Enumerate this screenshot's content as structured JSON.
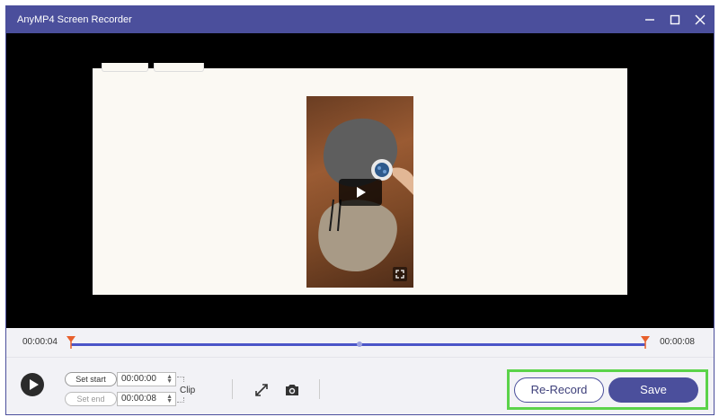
{
  "window": {
    "title": "AnyMP4 Screen Recorder",
    "controls": [
      "minimize-icon",
      "maximize-icon",
      "close-icon"
    ]
  },
  "timeline": {
    "start_time": "00:00:04",
    "end_time": "00:00:08"
  },
  "clip": {
    "set_start_label": "Set start",
    "set_start_value": "00:00:00",
    "set_end_label": "Set end",
    "set_end_value": "00:00:08",
    "clip_label": "Clip"
  },
  "tools": [
    "expand-icon",
    "camera-icon"
  ],
  "actions": {
    "rerecord_label": "Re-Record",
    "save_label": "Save"
  },
  "colors": {
    "accent": "#4b4f9c",
    "highlight": "#5bd34a",
    "marker": "#e8602c"
  }
}
